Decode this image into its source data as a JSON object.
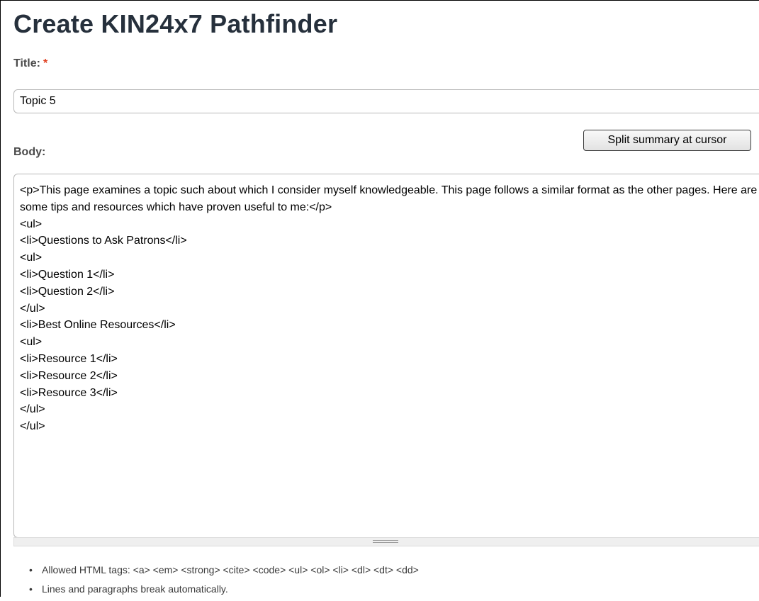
{
  "page": {
    "title": "Create KIN24x7 Pathfinder"
  },
  "form": {
    "title_label": "Title:",
    "required_marker": "*",
    "title_value": "Topic 5",
    "body_label": "Body:",
    "split_button_label": "Split summary at cursor",
    "body_value": "<p>This page examines a topic such about which I consider myself knowledgeable. This page follows a similar format as the other pages. Here are some tips and resources which have proven useful to me:</p>\n<ul>\n<li>Questions to Ask Patrons</li>\n<ul>\n<li>Question 1</li>\n<li>Question 2</li>\n</ul>\n<li>Best Online Resources</li>\n<ul>\n<li>Resource 1</li>\n<li>Resource 2</li>\n<li>Resource 3</li>\n</ul>\n</ul>"
  },
  "tips": [
    "Allowed HTML tags: <a> <em> <strong> <cite> <code> <ul> <ol> <li> <dl> <dt> <dd>",
    "Lines and paragraphs break automatically."
  ],
  "colors": {
    "heading": "#26303c",
    "label": "#4a4a4a",
    "required": "#e04020",
    "field_border": "#b8b8b8"
  }
}
